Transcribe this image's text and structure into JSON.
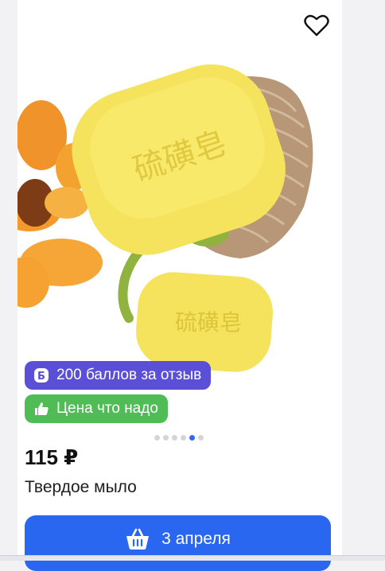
{
  "product": {
    "bonus_badge": "200 баллов за отзыв",
    "price_badge": "Цена что надо",
    "price": "115 ₽",
    "title": "Твердое мыло",
    "delivery_button": "3 апреля",
    "image_icon": "soap-photo",
    "gallery": {
      "total": 6,
      "active_index": 5
    },
    "colors": {
      "bonus_badge": "#5a4fd6",
      "price_badge": "#4fbc55",
      "button": "#2a67f0"
    },
    "soap_characters": "硫磺皂"
  }
}
